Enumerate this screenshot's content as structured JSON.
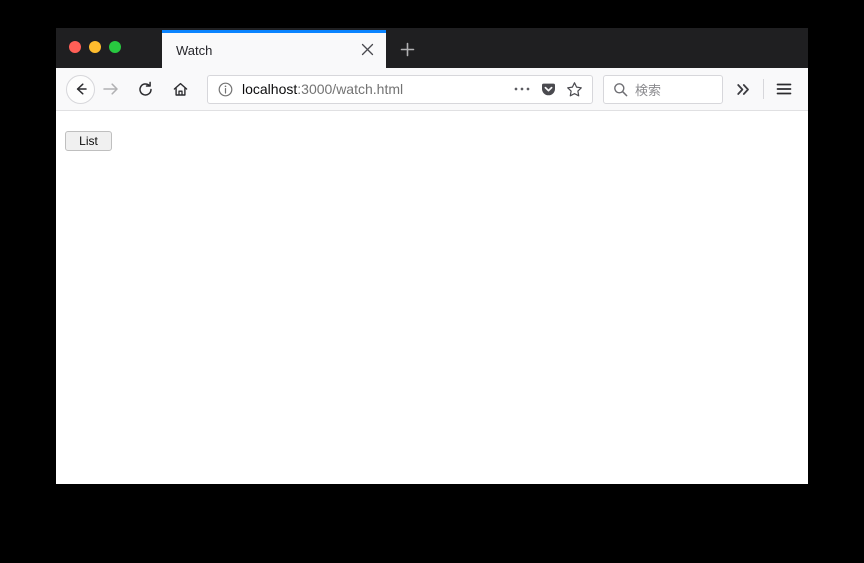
{
  "window": {
    "traffic_lights": [
      {
        "name": "close",
        "color": "#ff5f57"
      },
      {
        "name": "minimize",
        "color": "#febc2e"
      },
      {
        "name": "maximize",
        "color": "#28c840"
      }
    ]
  },
  "tabstrip": {
    "active_tab_indicator_color": "#0a84ff",
    "tabs": [
      {
        "title": "Watch",
        "close_label": "×",
        "active": true
      }
    ],
    "new_tab_label": "+"
  },
  "toolbar": {
    "back_icon": "back-arrow-icon",
    "forward_icon": "forward-arrow-icon",
    "reload_icon": "reload-icon",
    "home_icon": "home-icon",
    "urlbar": {
      "identity_icon": "info-circle-icon",
      "host": "localhost",
      "path": ":3000/watch.html",
      "full_url": "localhost:3000/watch.html",
      "actions": [
        {
          "name": "page-actions-menu",
          "icon": "ellipsis-icon",
          "label": "…"
        },
        {
          "name": "save-to-pocket",
          "icon": "pocket-icon",
          "label": ""
        },
        {
          "name": "bookmark-star",
          "icon": "star-icon",
          "label": ""
        }
      ]
    },
    "search": {
      "icon": "search-icon",
      "placeholder": "検索"
    },
    "overflow_icon": "chevron-double-right-icon",
    "menu_icon": "hamburger-menu-icon"
  },
  "page": {
    "buttons": [
      {
        "name": "list-button",
        "label": "List"
      }
    ]
  }
}
